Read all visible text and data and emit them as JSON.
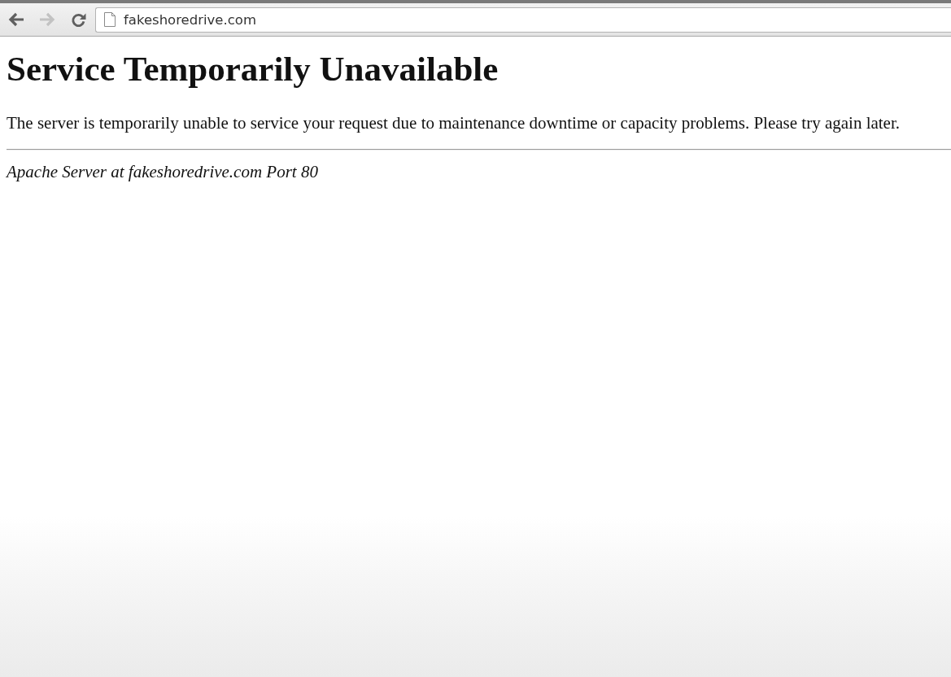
{
  "toolbar": {
    "back_button": {
      "disabled": false
    },
    "forward_button": {
      "disabled": true
    },
    "address_bar": {
      "value": "fakeshoredrive.com"
    }
  },
  "page": {
    "heading": "Service Temporarily Unavailable",
    "paragraph": "The server is temporarily unable to service your request due to maintenance downtime or capacity problems. Please try again later.",
    "address": "Apache Server at fakeshoredrive.com Port 80"
  }
}
